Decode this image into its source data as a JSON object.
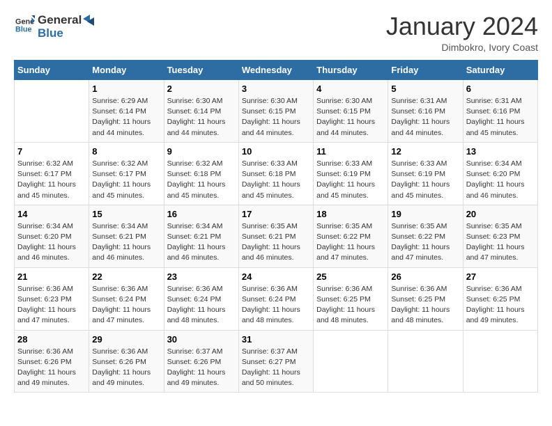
{
  "header": {
    "logo_line1": "General",
    "logo_line2": "Blue",
    "month": "January 2024",
    "location": "Dimbokro, Ivory Coast"
  },
  "days_of_week": [
    "Sunday",
    "Monday",
    "Tuesday",
    "Wednesday",
    "Thursday",
    "Friday",
    "Saturday"
  ],
  "weeks": [
    [
      {
        "day": "",
        "info": ""
      },
      {
        "day": "1",
        "info": "Sunrise: 6:29 AM\nSunset: 6:14 PM\nDaylight: 11 hours and 44 minutes."
      },
      {
        "day": "2",
        "info": "Sunrise: 6:30 AM\nSunset: 6:14 PM\nDaylight: 11 hours and 44 minutes."
      },
      {
        "day": "3",
        "info": "Sunrise: 6:30 AM\nSunset: 6:15 PM\nDaylight: 11 hours and 44 minutes."
      },
      {
        "day": "4",
        "info": "Sunrise: 6:30 AM\nSunset: 6:15 PM\nDaylight: 11 hours and 44 minutes."
      },
      {
        "day": "5",
        "info": "Sunrise: 6:31 AM\nSunset: 6:16 PM\nDaylight: 11 hours and 44 minutes."
      },
      {
        "day": "6",
        "info": "Sunrise: 6:31 AM\nSunset: 6:16 PM\nDaylight: 11 hours and 45 minutes."
      }
    ],
    [
      {
        "day": "7",
        "info": "Sunrise: 6:32 AM\nSunset: 6:17 PM\nDaylight: 11 hours and 45 minutes."
      },
      {
        "day": "8",
        "info": "Sunrise: 6:32 AM\nSunset: 6:17 PM\nDaylight: 11 hours and 45 minutes."
      },
      {
        "day": "9",
        "info": "Sunrise: 6:32 AM\nSunset: 6:18 PM\nDaylight: 11 hours and 45 minutes."
      },
      {
        "day": "10",
        "info": "Sunrise: 6:33 AM\nSunset: 6:18 PM\nDaylight: 11 hours and 45 minutes."
      },
      {
        "day": "11",
        "info": "Sunrise: 6:33 AM\nSunset: 6:19 PM\nDaylight: 11 hours and 45 minutes."
      },
      {
        "day": "12",
        "info": "Sunrise: 6:33 AM\nSunset: 6:19 PM\nDaylight: 11 hours and 45 minutes."
      },
      {
        "day": "13",
        "info": "Sunrise: 6:34 AM\nSunset: 6:20 PM\nDaylight: 11 hours and 46 minutes."
      }
    ],
    [
      {
        "day": "14",
        "info": "Sunrise: 6:34 AM\nSunset: 6:20 PM\nDaylight: 11 hours and 46 minutes."
      },
      {
        "day": "15",
        "info": "Sunrise: 6:34 AM\nSunset: 6:21 PM\nDaylight: 11 hours and 46 minutes."
      },
      {
        "day": "16",
        "info": "Sunrise: 6:34 AM\nSunset: 6:21 PM\nDaylight: 11 hours and 46 minutes."
      },
      {
        "day": "17",
        "info": "Sunrise: 6:35 AM\nSunset: 6:21 PM\nDaylight: 11 hours and 46 minutes."
      },
      {
        "day": "18",
        "info": "Sunrise: 6:35 AM\nSunset: 6:22 PM\nDaylight: 11 hours and 47 minutes."
      },
      {
        "day": "19",
        "info": "Sunrise: 6:35 AM\nSunset: 6:22 PM\nDaylight: 11 hours and 47 minutes."
      },
      {
        "day": "20",
        "info": "Sunrise: 6:35 AM\nSunset: 6:23 PM\nDaylight: 11 hours and 47 minutes."
      }
    ],
    [
      {
        "day": "21",
        "info": "Sunrise: 6:36 AM\nSunset: 6:23 PM\nDaylight: 11 hours and 47 minutes."
      },
      {
        "day": "22",
        "info": "Sunrise: 6:36 AM\nSunset: 6:24 PM\nDaylight: 11 hours and 47 minutes."
      },
      {
        "day": "23",
        "info": "Sunrise: 6:36 AM\nSunset: 6:24 PM\nDaylight: 11 hours and 48 minutes."
      },
      {
        "day": "24",
        "info": "Sunrise: 6:36 AM\nSunset: 6:24 PM\nDaylight: 11 hours and 48 minutes."
      },
      {
        "day": "25",
        "info": "Sunrise: 6:36 AM\nSunset: 6:25 PM\nDaylight: 11 hours and 48 minutes."
      },
      {
        "day": "26",
        "info": "Sunrise: 6:36 AM\nSunset: 6:25 PM\nDaylight: 11 hours and 48 minutes."
      },
      {
        "day": "27",
        "info": "Sunrise: 6:36 AM\nSunset: 6:25 PM\nDaylight: 11 hours and 49 minutes."
      }
    ],
    [
      {
        "day": "28",
        "info": "Sunrise: 6:36 AM\nSunset: 6:26 PM\nDaylight: 11 hours and 49 minutes."
      },
      {
        "day": "29",
        "info": "Sunrise: 6:36 AM\nSunset: 6:26 PM\nDaylight: 11 hours and 49 minutes."
      },
      {
        "day": "30",
        "info": "Sunrise: 6:37 AM\nSunset: 6:26 PM\nDaylight: 11 hours and 49 minutes."
      },
      {
        "day": "31",
        "info": "Sunrise: 6:37 AM\nSunset: 6:27 PM\nDaylight: 11 hours and 50 minutes."
      },
      {
        "day": "",
        "info": ""
      },
      {
        "day": "",
        "info": ""
      },
      {
        "day": "",
        "info": ""
      }
    ]
  ]
}
